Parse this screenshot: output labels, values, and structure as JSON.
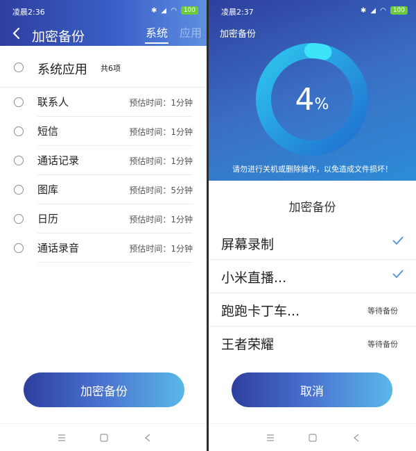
{
  "left": {
    "status_bar": {
      "time": "凌晨2:36",
      "battery": "100"
    },
    "header": {
      "title": "加密备份",
      "tabs": [
        {
          "label": "系统",
          "active": true
        },
        {
          "label": "应用",
          "active": false
        }
      ]
    },
    "section": {
      "label": "系统应用",
      "count": "共6项"
    },
    "items": [
      {
        "label": "联系人",
        "time": "预估时间：1分钟"
      },
      {
        "label": "短信",
        "time": "预估时间：1分钟"
      },
      {
        "label": "通话记录",
        "time": "预估时间：1分钟"
      },
      {
        "label": "图库",
        "time": "预估时间：5分钟"
      },
      {
        "label": "日历",
        "time": "预估时间：1分钟"
      },
      {
        "label": "通话录音",
        "time": "预估时间：1分钟"
      }
    ],
    "primary_button": "加密备份"
  },
  "right": {
    "status_bar": {
      "time": "凌晨2:37",
      "battery": "100"
    },
    "header": {
      "title": "加密备份"
    },
    "progress": {
      "value": "4",
      "unit": "%",
      "fraction": 0.04
    },
    "warning": "请勿进行关机或删除操作，以免造成文件损坏！",
    "sheet": {
      "title": "加密备份",
      "apps": [
        {
          "name": "屏幕录制",
          "status": "done",
          "status_text": ""
        },
        {
          "name": "小米直播...",
          "status": "done",
          "status_text": ""
        },
        {
          "name": "跑跑卡丁车...",
          "status": "pending",
          "status_text": "等待备份"
        },
        {
          "name": "王者荣耀",
          "status": "pending",
          "status_text": "等待备份"
        }
      ]
    },
    "cancel_button": "取消"
  },
  "colors": {
    "brand_dark": "#2e3f9e",
    "brand_light": "#5ab8e8",
    "check": "#4a90e2",
    "battery": "#6ccb3c"
  },
  "icons": {
    "back": "chevron-left-icon",
    "check": "check-icon",
    "nav": [
      "menu-icon",
      "home-square-icon",
      "back-triangle-icon"
    ]
  }
}
